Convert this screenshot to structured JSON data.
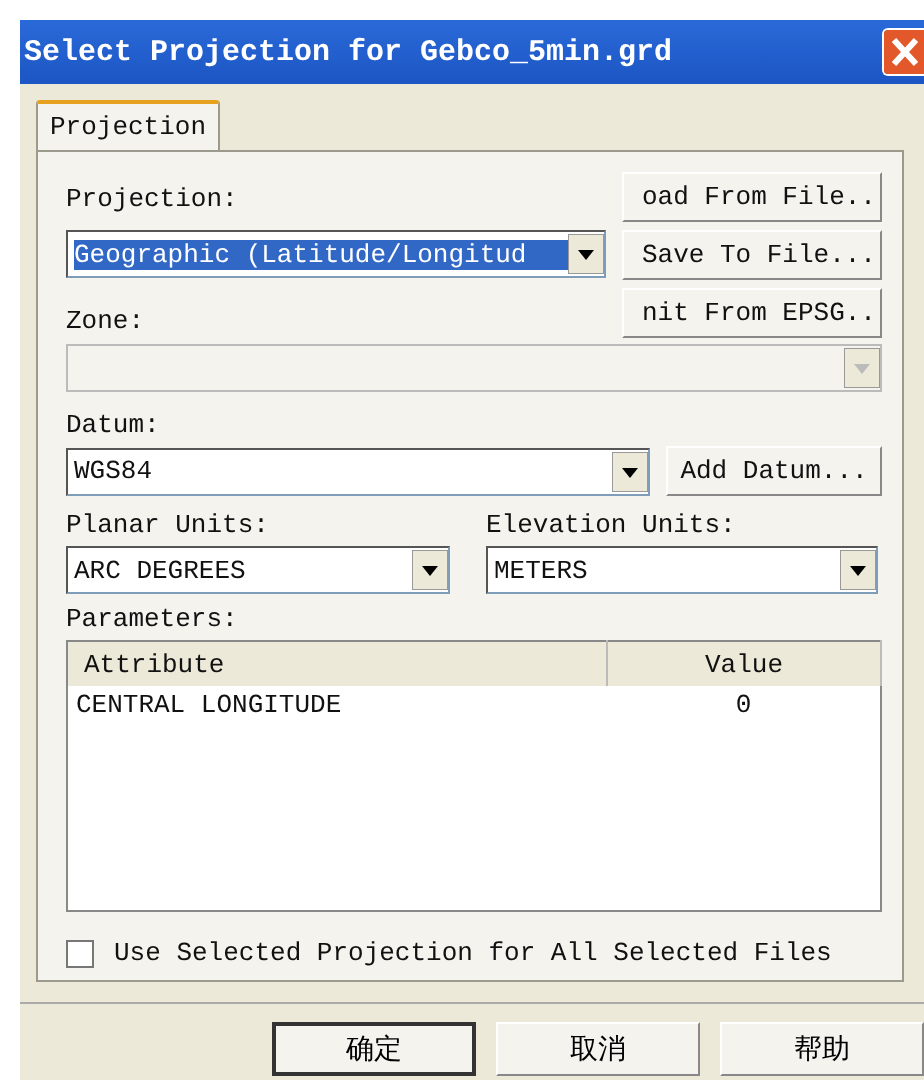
{
  "window": {
    "title": "Select Projection for Gebco_5min.grd"
  },
  "tabs": [
    {
      "label": "Projection",
      "selected": true
    }
  ],
  "projection": {
    "label": "Projection:",
    "value": "Geographic (Latitude/Longitud",
    "highlighted": true
  },
  "file_buttons": [
    "oad From File..",
    "Save To File...",
    "nit From EPSG.."
  ],
  "zone": {
    "label": "Zone:",
    "disabled": true
  },
  "datum": {
    "label": "Datum:",
    "value": "WGS84"
  },
  "add_datum_button": "Add Datum...",
  "planar_units": {
    "label": "Planar Units:",
    "value": "ARC DEGREES"
  },
  "elevation_units": {
    "label": "Elevation Units:",
    "value": "METERS"
  },
  "parameters": {
    "label": "Parameters:",
    "columns": [
      "Attribute",
      "Value"
    ],
    "rows": [
      {
        "attribute": "CENTRAL LONGITUDE",
        "value": "0"
      }
    ]
  },
  "apply_all": {
    "label": "Use Selected Projection for All Selected Files",
    "checked": false
  },
  "buttons": [
    {
      "label": "确定",
      "default": true
    },
    {
      "label": "取消",
      "default": false
    },
    {
      "label": "帮助",
      "default": false
    }
  ]
}
